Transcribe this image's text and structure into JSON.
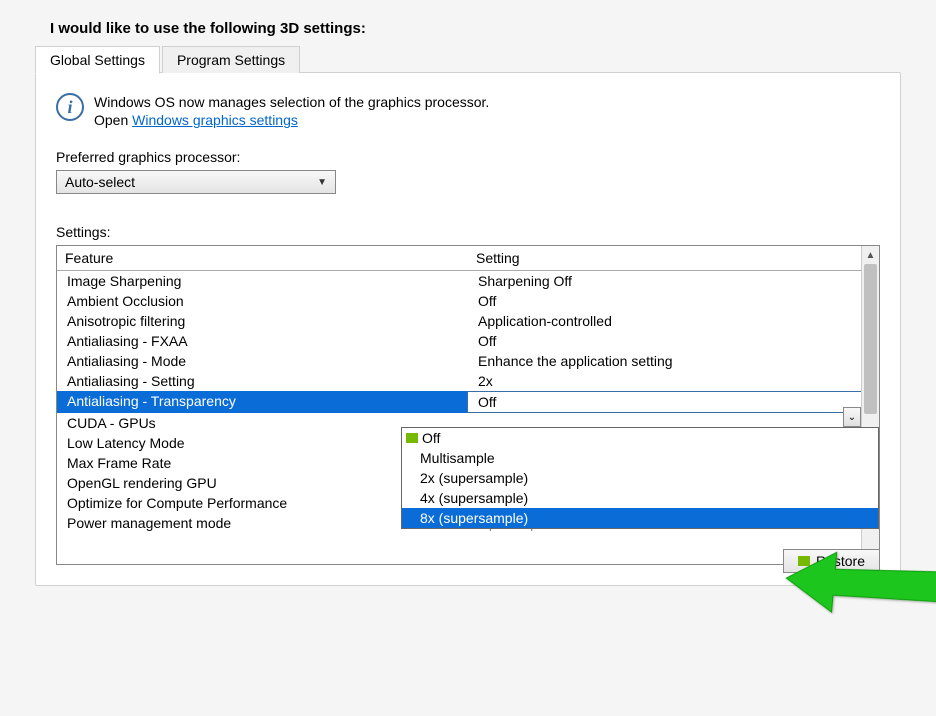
{
  "page_title": "I would like to use the following 3D settings:",
  "tabs": [
    {
      "label": "Global Settings",
      "active": true
    },
    {
      "label": "Program Settings",
      "active": false
    }
  ],
  "info": {
    "line1": "Windows OS now manages selection of the graphics processor.",
    "line2_prefix": "Open ",
    "link_text": "Windows graphics settings"
  },
  "preferred_label": "Preferred graphics processor:",
  "preferred_value": "Auto-select",
  "settings_label": "Settings:",
  "columns": {
    "feature": "Feature",
    "setting": "Setting"
  },
  "rows": [
    {
      "feature": "Image Sharpening",
      "setting": "Sharpening Off"
    },
    {
      "feature": "Ambient Occlusion",
      "setting": "Off"
    },
    {
      "feature": "Anisotropic filtering",
      "setting": "Application-controlled"
    },
    {
      "feature": "Antialiasing - FXAA",
      "setting": "Off"
    },
    {
      "feature": "Antialiasing - Mode",
      "setting": "Enhance the application setting"
    },
    {
      "feature": "Antialiasing - Setting",
      "setting": "2x"
    },
    {
      "feature": "Antialiasing - Transparency",
      "setting": "Off",
      "selected": true
    },
    {
      "feature": "CUDA - GPUs",
      "setting": ""
    },
    {
      "feature": "Low Latency Mode",
      "setting": ""
    },
    {
      "feature": "Max Frame Rate",
      "setting": ""
    },
    {
      "feature": "OpenGL rendering GPU",
      "setting": ""
    },
    {
      "feature": "Optimize for Compute Performance",
      "setting": ""
    },
    {
      "feature": "Power management mode",
      "setting": "Optimal power"
    }
  ],
  "dropdown_options": [
    {
      "label": "Off",
      "nvidia": true
    },
    {
      "label": "Multisample"
    },
    {
      "label": "2x (supersample)"
    },
    {
      "label": "4x (supersample)"
    },
    {
      "label": "8x (supersample)",
      "highlighted": true
    }
  ],
  "restore_label": "Restore"
}
